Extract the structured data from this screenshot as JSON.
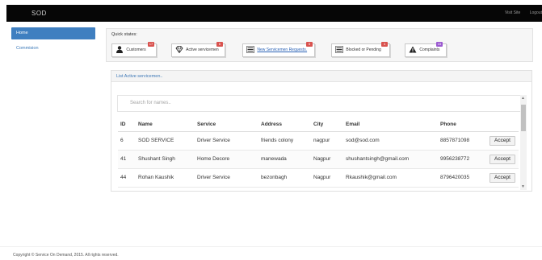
{
  "header": {
    "brand": "SOD",
    "visit_site": "Visit Site",
    "logout": "Logout"
  },
  "sidebar": {
    "items": [
      {
        "label": "Home",
        "active": true
      },
      {
        "label": "Commision",
        "active": false
      }
    ]
  },
  "quick_states": {
    "title": "Quick states:",
    "buttons": [
      {
        "label": "Customers",
        "badge": "17",
        "icon": "person-icon",
        "badge_color": "#d9534f"
      },
      {
        "label": "Active servicemen",
        "badge": "6",
        "icon": "diamond-icon",
        "badge_color": "#d9534f"
      },
      {
        "label": "New Servicemen Requests.",
        "badge": "5",
        "icon": "list-icon",
        "badge_color": "#d9534f"
      },
      {
        "label": "Blocked or Pending",
        "badge": "4",
        "icon": "list-icon",
        "badge_color": "#d9534f"
      },
      {
        "label": "Complaints",
        "badge": "15",
        "icon": "warning-icon",
        "badge_color": "#9b59d0"
      }
    ]
  },
  "panel": {
    "title": "List Active servicemen..",
    "search_placeholder": "Search for names.."
  },
  "table": {
    "headers": [
      "ID",
      "Name",
      "Service",
      "Address",
      "City",
      "Email",
      "Phone"
    ],
    "rows": [
      [
        "6",
        "SOD SERVICE",
        "Driver Service",
        "friends colony",
        "nagpur",
        "sod@sod.com",
        "8857871098"
      ],
      [
        "41",
        "Shushant Singh",
        "Home Decore",
        "manewada",
        "Nagpur",
        "shushantsingh@gmail.com",
        "9956238772"
      ],
      [
        "44",
        "Rohan Kaushik",
        "Driver Service",
        "bezonbagh",
        "Nagpur",
        "Rkaushik@gmail.com",
        "8796420035"
      ]
    ],
    "action_label": "Accept"
  },
  "footer": {
    "text": "Copyright © Service On Demand, 2015. All rights reserved."
  }
}
